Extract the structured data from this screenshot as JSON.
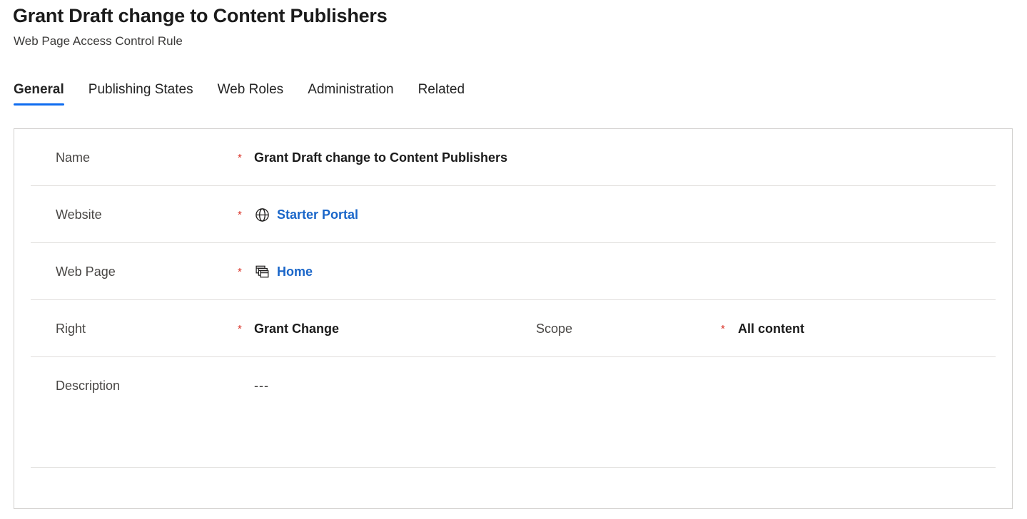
{
  "header": {
    "title": "Grant Draft change to Content Publishers",
    "subtitle": "Web Page Access Control Rule"
  },
  "tabs": [
    {
      "label": "General",
      "active": true
    },
    {
      "label": "Publishing States",
      "active": false
    },
    {
      "label": "Web Roles",
      "active": false
    },
    {
      "label": "Administration",
      "active": false
    },
    {
      "label": "Related",
      "active": false
    }
  ],
  "form": {
    "required_marker": "*",
    "rows": [
      {
        "label": "Name",
        "required": true,
        "value": "Grant Draft change to Content Publishers",
        "kind": "text"
      },
      {
        "label": "Website",
        "required": true,
        "value": "Starter Portal",
        "kind": "link",
        "icon": "globe-icon"
      },
      {
        "label": "Web Page",
        "required": true,
        "value": "Home",
        "kind": "link",
        "icon": "stacked-windows-icon"
      },
      {
        "label": "Right",
        "required": true,
        "value": "Grant Change",
        "kind": "text",
        "second": {
          "label": "Scope",
          "required": true,
          "value": "All content"
        }
      },
      {
        "label": "Description",
        "required": false,
        "value": "---",
        "kind": "plain"
      }
    ]
  },
  "colors": {
    "accent": "#0f6cf0",
    "link": "#1a66c9",
    "required": "#d93025",
    "border": "#d2d0ce",
    "divider": "#e1dfdd",
    "label": "#484644",
    "value": "#1b1b1b"
  }
}
